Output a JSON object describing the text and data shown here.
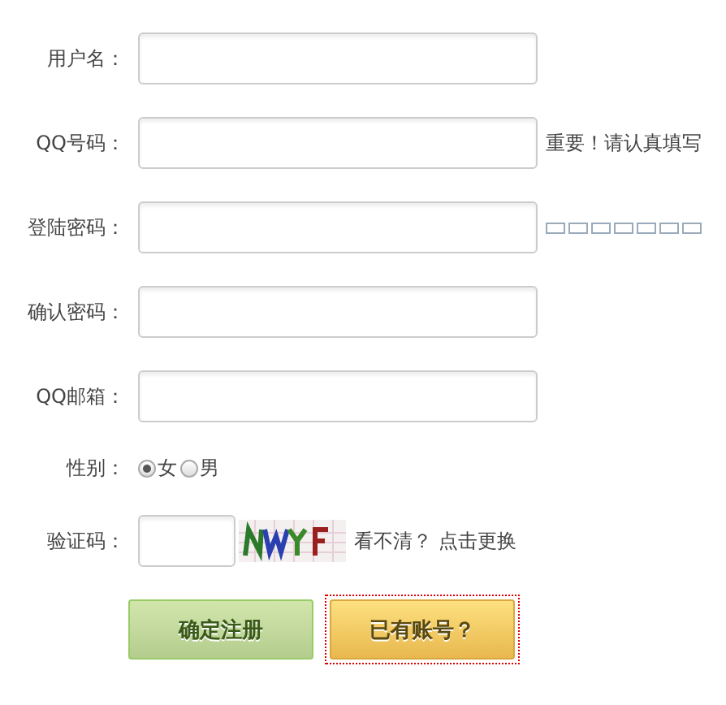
{
  "fields": [
    {
      "label": "用户名："
    },
    {
      "label": "QQ号码：",
      "hint": "重要！请认真填写"
    },
    {
      "label": "登陆密码：",
      "strength_meter": true
    },
    {
      "label": "确认密码："
    },
    {
      "label": "QQ邮箱："
    }
  ],
  "gender": {
    "label": "性别：",
    "options": [
      {
        "label": "女",
        "selected": true
      },
      {
        "label": "男",
        "selected": false
      }
    ]
  },
  "captcha": {
    "label": "验证码：",
    "refresh_link": "看不清？ 点击更换"
  },
  "buttons": [
    {
      "label": "确定注册",
      "kind": "primary",
      "focused": false
    },
    {
      "label": "已有账号？",
      "kind": "secondary",
      "focused": true
    }
  ]
}
